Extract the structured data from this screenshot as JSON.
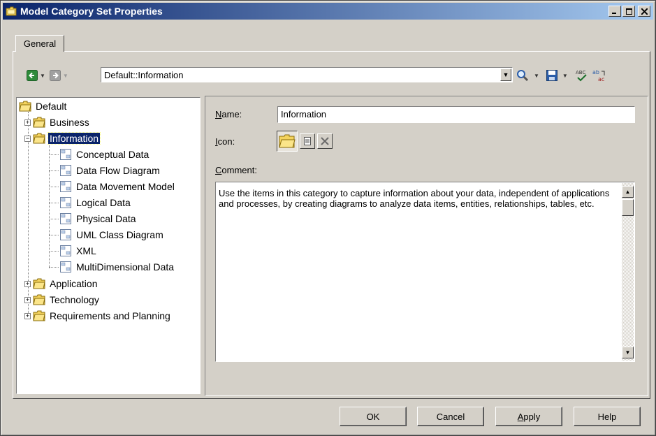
{
  "window": {
    "title": "Model Category Set Properties"
  },
  "tabs": [
    {
      "label": "General"
    }
  ],
  "toolbar": {
    "path_value": "Default::Information"
  },
  "tree": {
    "root": "Default",
    "items": [
      {
        "label": "Business"
      },
      {
        "label": "Information"
      },
      {
        "label": "Conceptual Data"
      },
      {
        "label": "Data Flow Diagram"
      },
      {
        "label": "Data Movement Model"
      },
      {
        "label": "Logical Data"
      },
      {
        "label": "Physical Data"
      },
      {
        "label": "UML Class Diagram"
      },
      {
        "label": "XML"
      },
      {
        "label": "MultiDimensional Data"
      },
      {
        "label": "Application"
      },
      {
        "label": "Technology"
      },
      {
        "label": "Requirements and Planning"
      }
    ]
  },
  "form": {
    "name_label_u": "N",
    "name_label_rest": "ame:",
    "name_value": "Information",
    "icon_label_u": "I",
    "icon_label_rest": "con:",
    "comment_label_u": "C",
    "comment_label_rest": "omment:",
    "comment_value": "Use the items in this category to capture information about your data, independent of applications and processes, by creating diagrams to analyze data items, entities, relationships, tables, etc."
  },
  "buttons": {
    "ok": "OK",
    "cancel": "Cancel",
    "apply_u": "A",
    "apply_rest": "pply",
    "help": "Help"
  },
  "colors": {
    "title_bar": "#0a246a",
    "selection": "#0a246a",
    "face": "#d4d0c8"
  }
}
